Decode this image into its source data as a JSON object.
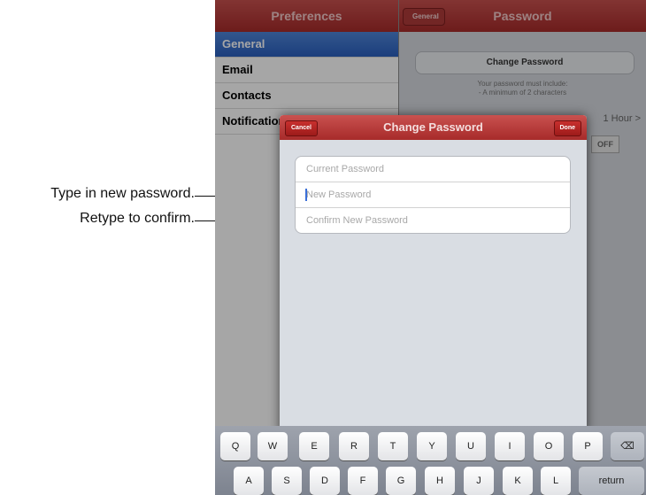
{
  "callouts": {
    "new_password": "Type in new password.",
    "confirm": "Retype to confirm."
  },
  "master": {
    "title": "Preferences",
    "items": [
      {
        "label": "General",
        "selected": true
      },
      {
        "label": "Email"
      },
      {
        "label": "Contacts"
      },
      {
        "label": "Notifications"
      }
    ]
  },
  "detail": {
    "title": "Password",
    "back_label": "General",
    "group_title": "Change Password",
    "note_line1": "Your password must include:",
    "note_line2": "- A minimum of 2 characters",
    "timeout_value": "1 Hour",
    "chevron": ">",
    "toggle_value": "OFF"
  },
  "modal": {
    "title": "Change Password",
    "cancel_label": "Cancel",
    "done_label": "Done",
    "fields": {
      "current_placeholder": "Current Password",
      "new_placeholder": "New Password",
      "confirm_placeholder": "Confirm New Password"
    }
  },
  "keyboard": {
    "row1": [
      "Q",
      "W",
      "E",
      "R",
      "T",
      "Y",
      "U",
      "I",
      "O",
      "P"
    ],
    "row2": [
      "A",
      "S",
      "D",
      "F",
      "G",
      "H",
      "J",
      "K",
      "L"
    ],
    "backspace": "⌫",
    "return_label": "return"
  },
  "colors": {
    "accent_red": "#b23a38",
    "selection_blue": "#2a5fbf"
  }
}
